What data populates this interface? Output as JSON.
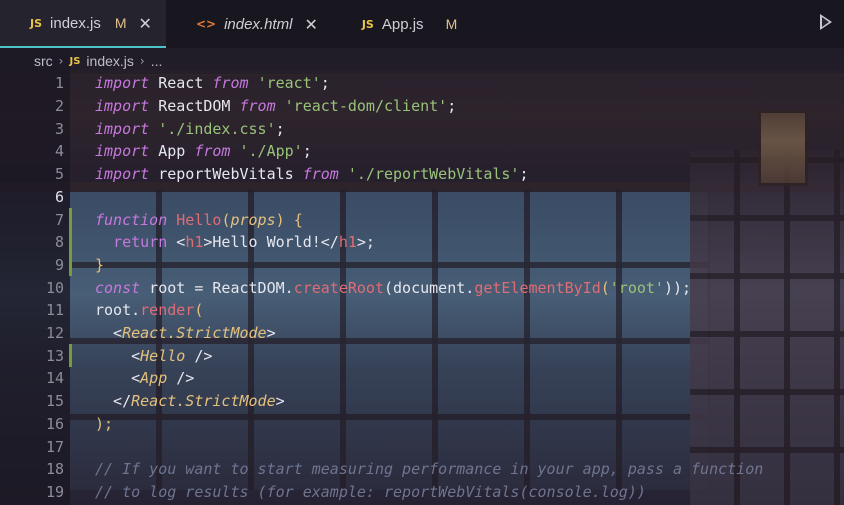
{
  "tabs": [
    {
      "icon": "JS",
      "name": "index.js",
      "status": "M",
      "active": true
    },
    {
      "icon": "<>",
      "name": "index.html",
      "status": "",
      "active": false
    },
    {
      "icon": "JS",
      "name": "App.js",
      "status": "M",
      "active": false
    }
  ],
  "close_glyph": "✕",
  "breadcrumb": {
    "folder": "src",
    "file_icon": "JS",
    "file": "index.js",
    "more": "..."
  },
  "line_numbers": [
    "1",
    "2",
    "3",
    "4",
    "5",
    "6",
    "7",
    "8",
    "9",
    "10",
    "11",
    "12",
    "13",
    "14",
    "15",
    "16",
    "17",
    "18",
    "19"
  ],
  "code": {
    "l1": [
      "import",
      " React ",
      "from",
      " ",
      "'react'",
      ";"
    ],
    "l2": [
      "import",
      " ReactDOM ",
      "from",
      " ",
      "'react-dom/client'",
      ";"
    ],
    "l3": [
      "import",
      " ",
      "'./index.css'",
      ";"
    ],
    "l4": [
      "import",
      " App ",
      "from",
      " ",
      "'./App'",
      ";"
    ],
    "l5": [
      "import",
      " reportWebVitals ",
      "from",
      " ",
      "'./reportWebVitals'",
      ";"
    ],
    "l7": [
      "function",
      " ",
      "Hello",
      "(",
      "props",
      ") ",
      "{"
    ],
    "l8": [
      "  ",
      "return",
      " <",
      "h1",
      ">Hello World!</",
      "h1",
      ">;"
    ],
    "l9": [
      "}"
    ],
    "l10": [
      "const",
      " root = ReactDOM.",
      "createRoot",
      "(document.",
      "getElementById",
      "(",
      "'root'",
      "));"
    ],
    "l11": [
      "root.",
      "render",
      "("
    ],
    "l12": [
      "  <",
      "React.StrictMode",
      ">"
    ],
    "l13": [
      "    <",
      "Hello",
      " />"
    ],
    "l14": [
      "    <",
      "App",
      " />"
    ],
    "l15": [
      "  </",
      "React.StrictMode",
      ">"
    ],
    "l16": [
      ");"
    ],
    "l18": [
      "// If you want to start measuring performance in your app, pass a function"
    ],
    "l19": [
      "// to log results (for example: reportWebVitals(console.log))"
    ]
  },
  "colors": {
    "accent": "#4fc1c9",
    "modified": "#e2c08d",
    "js_icon": "#e8c54a",
    "html_icon": "#e37933"
  }
}
